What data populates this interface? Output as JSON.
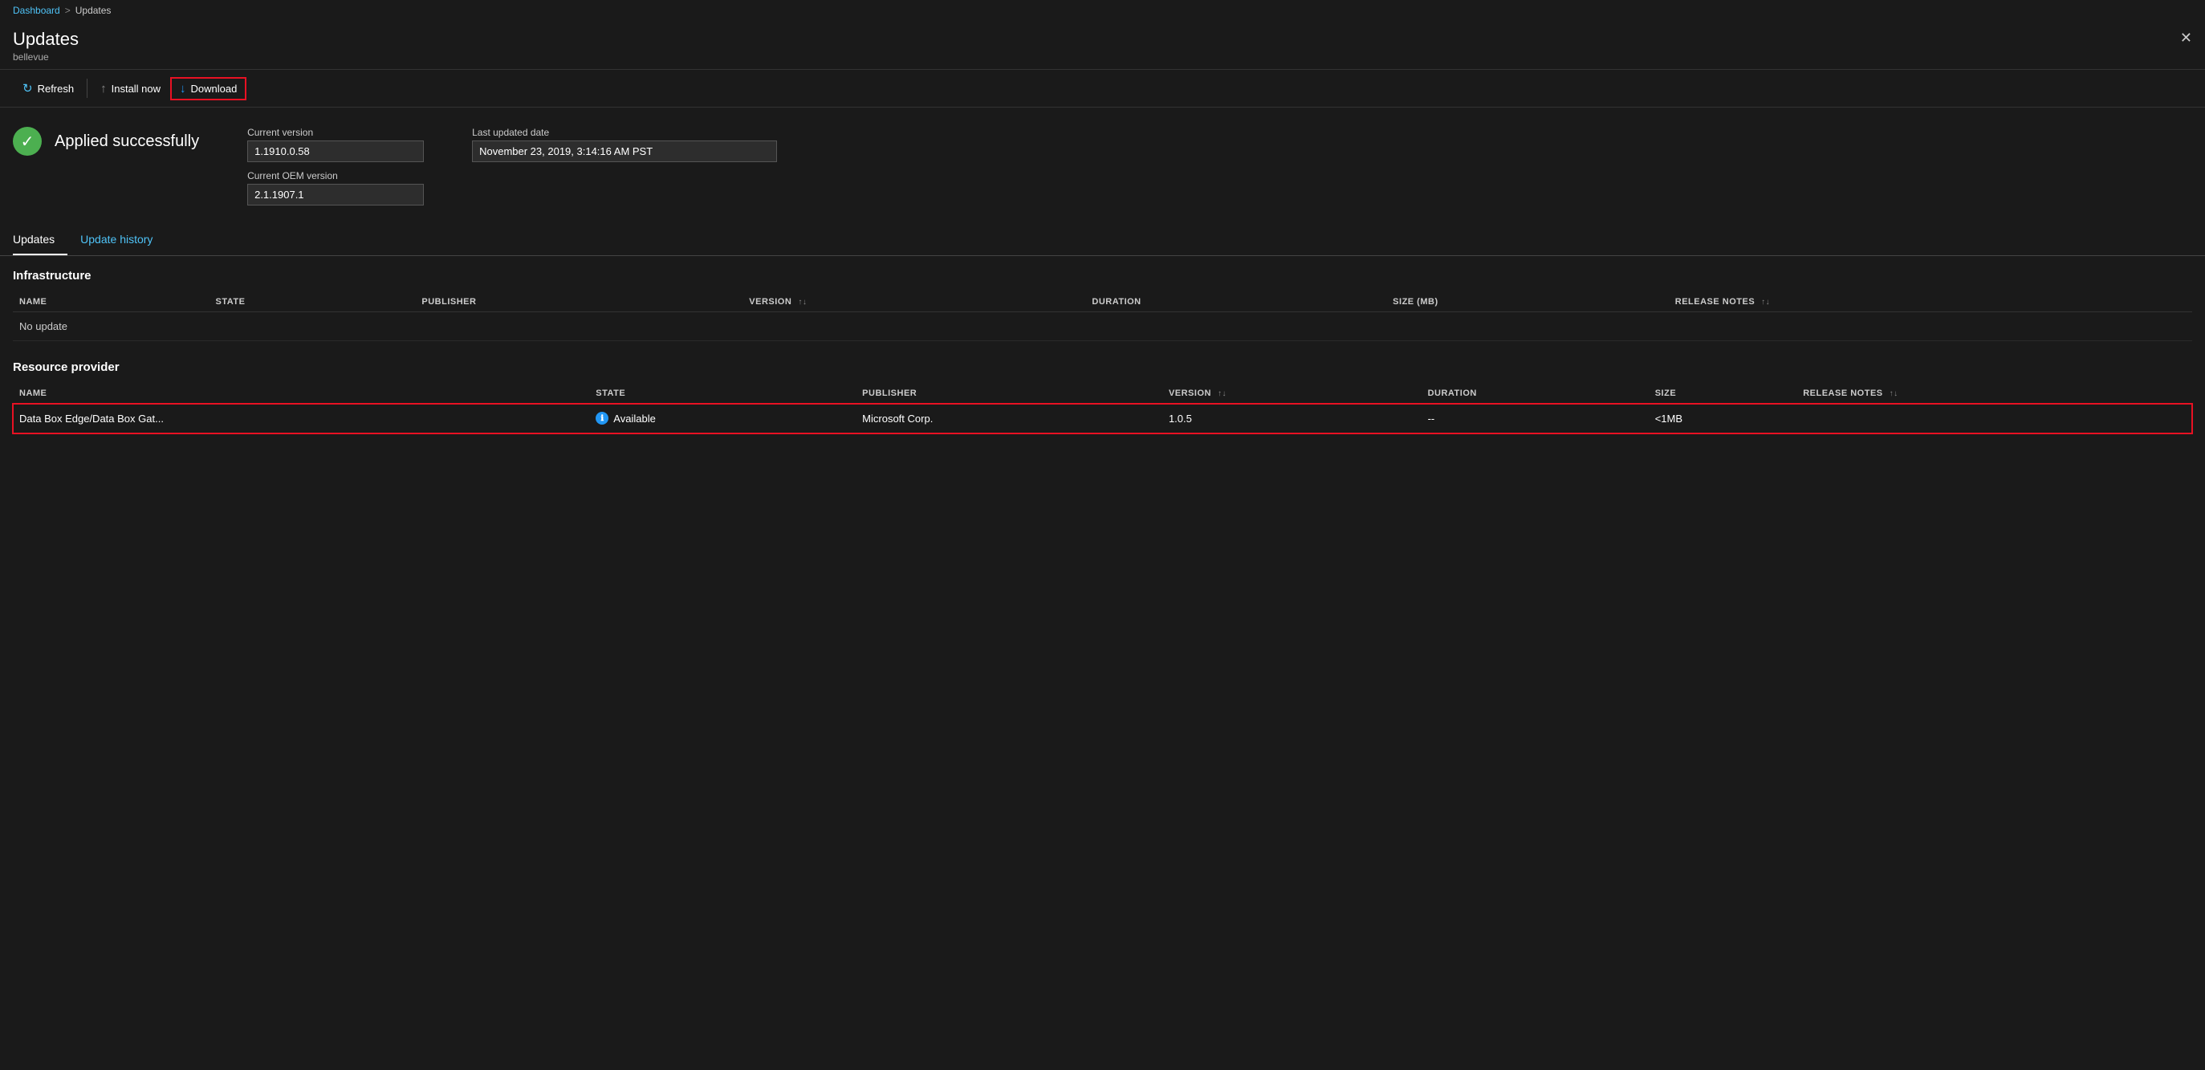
{
  "breadcrumb": {
    "parent": "Dashboard",
    "separator": ">",
    "current": "Updates"
  },
  "page": {
    "title": "Updates",
    "subtitle": "bellevue",
    "close_label": "✕"
  },
  "toolbar": {
    "refresh_label": "Refresh",
    "install_label": "Install now",
    "download_label": "Download"
  },
  "status": {
    "icon": "✓",
    "text": "Applied successfully",
    "current_version_label": "Current version",
    "current_version_value": "1.1910.0.58",
    "current_oem_label": "Current OEM version",
    "current_oem_value": "2.1.1907.1",
    "last_updated_label": "Last updated date",
    "last_updated_value": "November 23, 2019, 3:14:16 AM PST"
  },
  "tabs": [
    {
      "label": "Updates",
      "active": true
    },
    {
      "label": "Update history",
      "active": false
    }
  ],
  "infrastructure": {
    "title": "Infrastructure",
    "columns": [
      {
        "label": "NAME",
        "sortable": false
      },
      {
        "label": "STATE",
        "sortable": false
      },
      {
        "label": "PUBLISHER",
        "sortable": false
      },
      {
        "label": "VERSION",
        "sortable": true
      },
      {
        "label": "DURATION",
        "sortable": false
      },
      {
        "label": "SIZE (MB)",
        "sortable": false
      },
      {
        "label": "RELEASE NOTES",
        "sortable": true
      }
    ],
    "rows": [
      {
        "name": "No update",
        "state": "",
        "publisher": "",
        "version": "",
        "duration": "",
        "size": "",
        "release_notes": ""
      }
    ]
  },
  "resource_provider": {
    "title": "Resource provider",
    "columns": [
      {
        "label": "NAME",
        "sortable": false
      },
      {
        "label": "STATE",
        "sortable": false
      },
      {
        "label": "PUBLISHER",
        "sortable": false
      },
      {
        "label": "VERSION",
        "sortable": true
      },
      {
        "label": "DURATION",
        "sortable": false
      },
      {
        "label": "SIZE",
        "sortable": false
      },
      {
        "label": "RELEASE NOTES",
        "sortable": true
      }
    ],
    "rows": [
      {
        "name": "Data Box Edge/Data Box Gat...",
        "state": "Available",
        "publisher": "Microsoft Corp.",
        "version": "1.0.5",
        "duration": "--",
        "size": "<1MB",
        "release_notes": "",
        "highlighted": true
      }
    ]
  },
  "icons": {
    "refresh": "↻",
    "install": "↑",
    "download": "↓",
    "sort_updown": "↑↓",
    "info": "ℹ"
  }
}
